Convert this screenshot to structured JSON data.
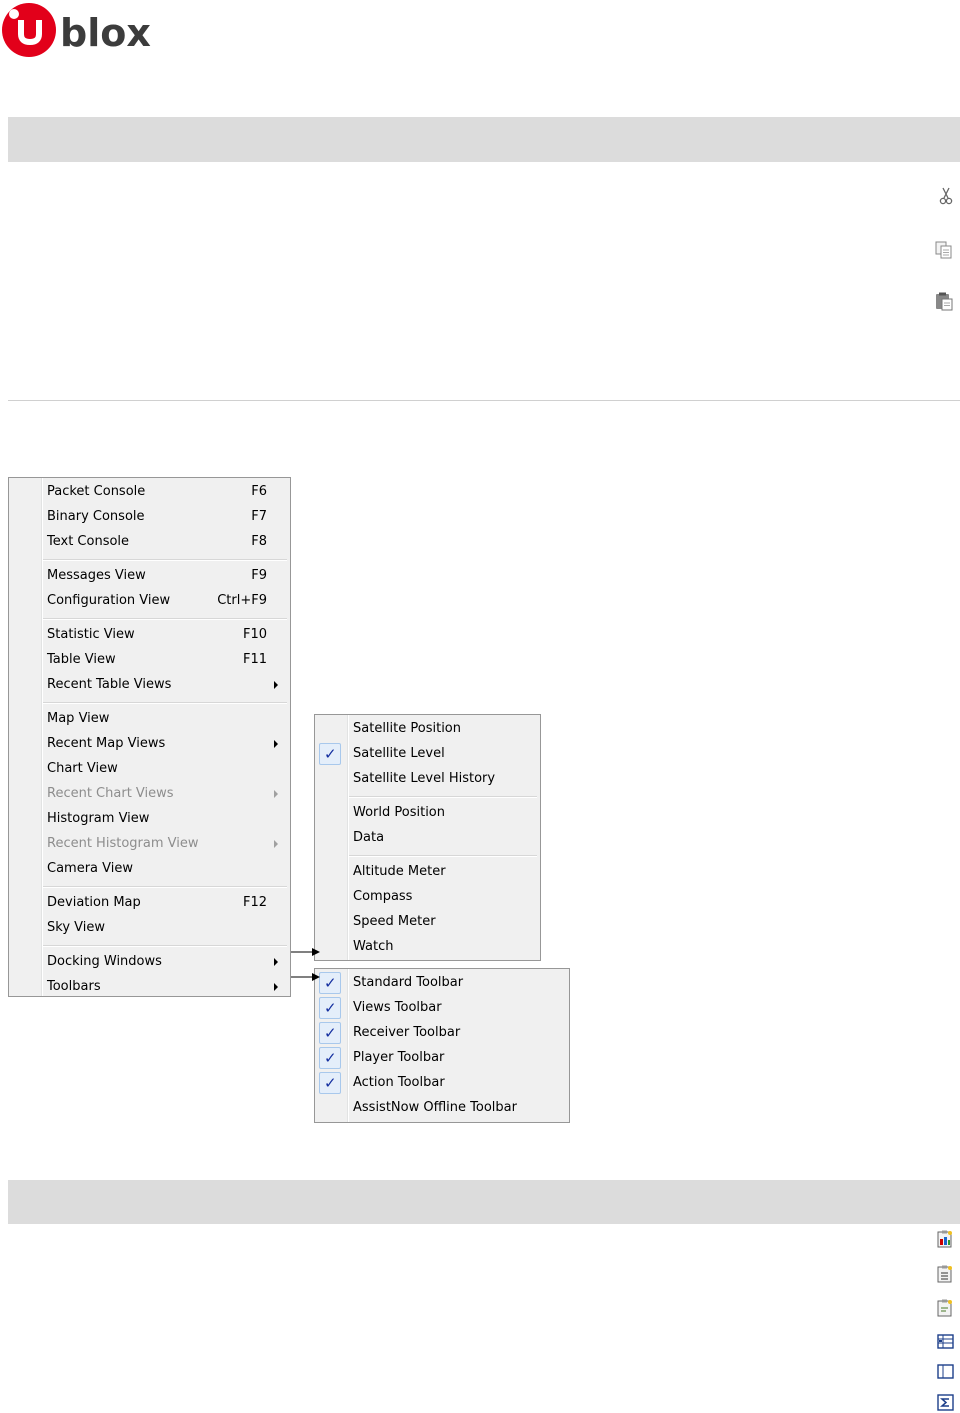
{
  "logo": {
    "text": "ublox",
    "colors": {
      "brand_red": "#e2001a",
      "brand_gray": "#3c3c3c"
    }
  },
  "toolbar_icons_top": [
    "scissors-icon",
    "copy-icon",
    "paste-icon"
  ],
  "toolbar_icons_bottom": [
    "load-config-icon",
    "export-config-icon",
    "edit-config-icon",
    "table-layout-icon",
    "panel-layout-icon",
    "sum-icon"
  ],
  "main_menu": {
    "groups": [
      [
        {
          "label": "Packet Console",
          "shortcut": "F6"
        },
        {
          "label": "Binary Console",
          "shortcut": "F7"
        },
        {
          "label": "Text Console",
          "shortcut": "F8"
        }
      ],
      [
        {
          "label": "Messages View",
          "shortcut": "F9"
        },
        {
          "label": "Configuration View",
          "shortcut": "Ctrl+F9"
        }
      ],
      [
        {
          "label": "Statistic View",
          "shortcut": "F10"
        },
        {
          "label": "Table View",
          "shortcut": "F11"
        },
        {
          "label": "Recent Table Views",
          "submenu": true
        }
      ],
      [
        {
          "label": "Map View"
        },
        {
          "label": "Recent Map Views",
          "submenu": true
        },
        {
          "label": "Chart View"
        },
        {
          "label": "Recent Chart Views",
          "submenu": true,
          "disabled": true
        },
        {
          "label": "Histogram View"
        },
        {
          "label": "Recent Histogram View",
          "submenu": true,
          "disabled": true
        },
        {
          "label": "Camera View"
        }
      ],
      [
        {
          "label": "Deviation Map",
          "shortcut": "F12"
        },
        {
          "label": "Sky View"
        }
      ],
      [
        {
          "label": "Docking Windows",
          "submenu": true
        },
        {
          "label": "Toolbars",
          "submenu": true
        }
      ]
    ]
  },
  "docking_menu": {
    "groups": [
      [
        {
          "label": "Satellite Position"
        },
        {
          "label": "Satellite Level",
          "checked": true
        },
        {
          "label": "Satellite Level History"
        }
      ],
      [
        {
          "label": "World Position"
        },
        {
          "label": "Data"
        }
      ],
      [
        {
          "label": "Altitude Meter"
        },
        {
          "label": "Compass"
        },
        {
          "label": "Speed Meter"
        },
        {
          "label": "Watch"
        }
      ]
    ]
  },
  "toolbars_menu": {
    "items": [
      {
        "label": "Standard Toolbar",
        "checked": true
      },
      {
        "label": "Views Toolbar",
        "checked": true
      },
      {
        "label": "Receiver Toolbar",
        "checked": true
      },
      {
        "label": "Player Toolbar",
        "checked": true
      },
      {
        "label": "Action Toolbar",
        "checked": true
      },
      {
        "label": "AssistNow Offline Toolbar"
      }
    ]
  }
}
